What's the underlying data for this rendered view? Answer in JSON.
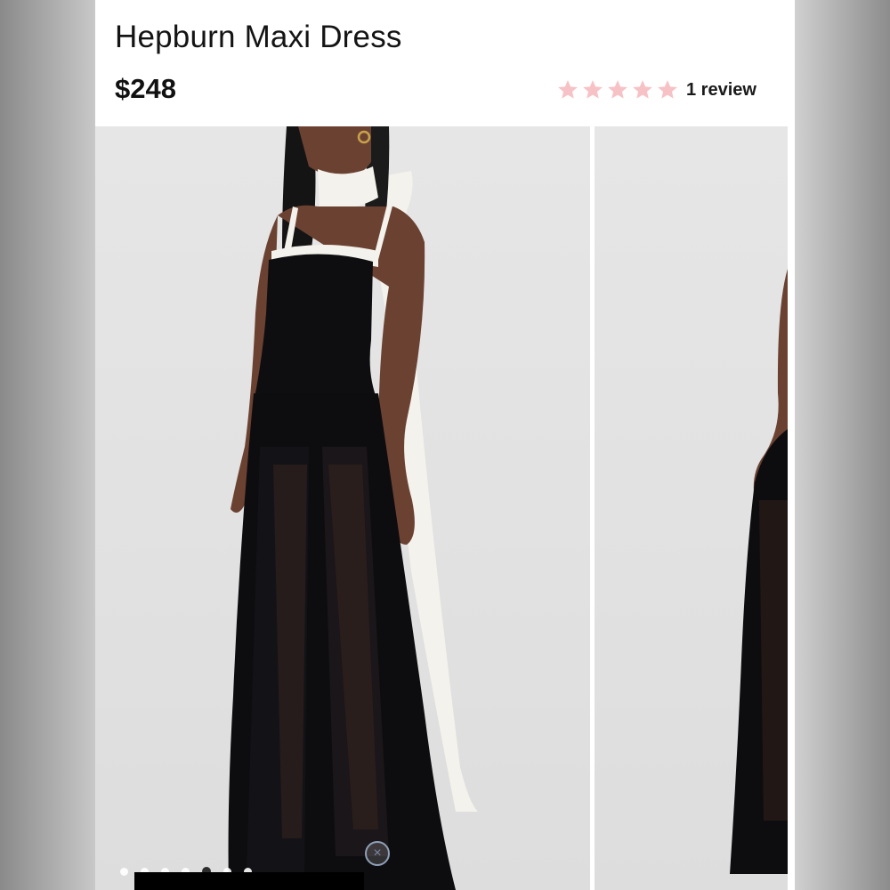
{
  "product": {
    "title": "Hepburn Maxi Dress",
    "price": "$248",
    "rating": {
      "stars": 5,
      "review_text": "1 review",
      "star_color": "#f7c2c6"
    }
  },
  "gallery": {
    "images": [
      {
        "icon": "product-photo-front"
      },
      {
        "icon": "product-photo-back"
      }
    ],
    "pagination": {
      "count": 7,
      "active_index": 4
    },
    "close_icon": "×"
  },
  "colors": {
    "dress": "#0e0e10",
    "scarf": "#f4f2ec",
    "backdrop": "#e3e3e3"
  }
}
